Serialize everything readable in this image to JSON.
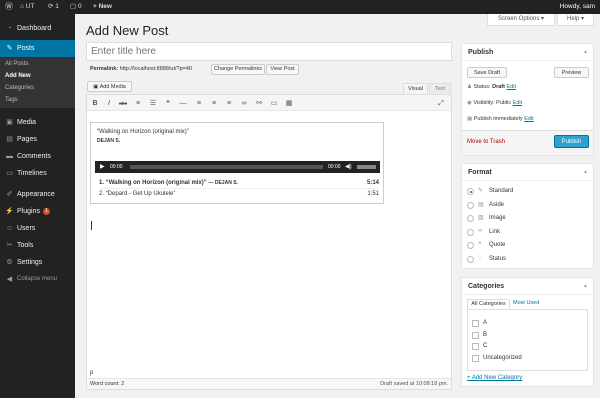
{
  "adminbar": {
    "wp_icon": "wordpress-icon",
    "site": "UT",
    "updates": "1",
    "comments": "0",
    "new": "+ New",
    "howdy": "Howdy, sam"
  },
  "sidebar": {
    "dashboard": "Dashboard",
    "posts": "Posts",
    "sub": [
      "All Posts",
      "Add New",
      "Categories",
      "Tags"
    ],
    "media": "Media",
    "pages": "Pages",
    "comments": "Comments",
    "timelines": "Timelines",
    "appearance": "Appearance",
    "plugins": "Plugins",
    "plugins_badge": "1",
    "users": "Users",
    "tools": "Tools",
    "settings": "Settings",
    "collapse": "Collapse menu"
  },
  "screen_options": "Screen Options ▾",
  "help": "Help ▾",
  "page_title": "Add New Post",
  "title_placeholder": "Enter title here",
  "permalink": {
    "label": "Permalink:",
    "url": "http://localhost:8888/ut/?p=40",
    "change": "Change Permalinks",
    "view": "View Post"
  },
  "editor": {
    "add_media": "Add Media",
    "tab_visual": "Visual",
    "tab_text": "Text",
    "word_count": "Word count: 2",
    "draft_saved": "Draft saved at 10:08:18 pm.",
    "path": "p"
  },
  "playlist": {
    "title": "“Walking on Horizon (original mix)”",
    "artist": "DEJAN S.",
    "time_start": "00:00",
    "time_end": "00:00",
    "tracks": [
      {
        "n": "1.",
        "title": "“Walking on Horizon (original mix)”",
        "artist": "— DEJAN S.",
        "dur": "5:14"
      },
      {
        "n": "2.",
        "title": "“Depard - Get Up Ukulele”",
        "artist": "",
        "dur": "1:51"
      }
    ]
  },
  "publish": {
    "title": "Publish",
    "save_draft": "Save Draft",
    "preview": "Preview",
    "status_label": "Status:",
    "status": "Draft",
    "visibility_label": "Visibility:",
    "visibility": "Public",
    "schedule": "Publish immediately",
    "edit": "Edit",
    "trash": "Move to Trash",
    "publish_btn": "Publish"
  },
  "format": {
    "title": "Format",
    "options": [
      "Standard",
      "Aside",
      "Image",
      "Link",
      "Quote",
      "Status"
    ]
  },
  "categories": {
    "title": "Categories",
    "tab_all": "All Categories",
    "tab_used": "Most Used",
    "items": [
      "A",
      "B",
      "C",
      "Uncategorized"
    ],
    "add": "+ Add New Category"
  }
}
